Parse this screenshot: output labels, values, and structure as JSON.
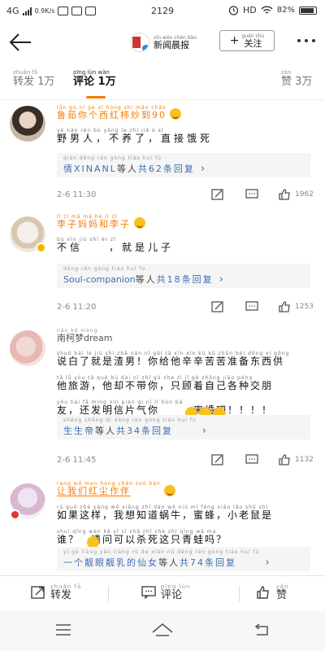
{
  "status_bar": {
    "network": "4G",
    "speed": "0.9K/s",
    "time": "2129",
    "hd": "HD",
    "battery": "82%"
  },
  "nav": {
    "account_pinyin": "xīn wén chén bào",
    "account_name": "新闻晨报",
    "follow_pinyin": "guān zhù",
    "follow_label": "关注"
  },
  "tabs": [
    {
      "pinyin": "zhuǎn fā",
      "label": "转发",
      "count": "1万",
      "active": false
    },
    {
      "pinyin": "pīng lùn   wàn",
      "label": "评论",
      "count": "1万",
      "active": true
    },
    {
      "pinyin": "zàn",
      "label": "赞",
      "count": "3万",
      "active": false
    }
  ],
  "comments": [
    {
      "user_pinyin": "lǚn  gù  ní  gè  xī  hóng shì mǎo chǎo",
      "username": "鲁茹你个西红柿炒到90",
      "text_pinyin": "yě  nán rén   bù yǎng le   zhí  jiē  è  sǐ",
      "text": "野男人，不养了，直接饿死",
      "reply_pinyin": "qián      děng rén  gòng   tiáo huí  fù",
      "reply_user": "倩XINANL",
      "reply_mid": "等人",
      "reply_count": "共62条回复",
      "time": "2-6 11:30",
      "likes": "1962"
    },
    {
      "user_pinyin": "lǐ   zǐ  mā mā  hé  lǐ  zǐ",
      "username": "李子妈妈和李子",
      "text_pinyin": "bù  xìn      jiù  shì  ér  zǐ",
      "text": "不信　　，就是儿子",
      "reply_pinyin": "                  děng rén   gòng    tiáo huí  fù",
      "reply_user": "Soul-companion",
      "reply_mid": "等人",
      "reply_count": "共18条回复",
      "time": "2-6 11:20",
      "likes": "1253"
    },
    {
      "user_pinyin": "nán kē mèng",
      "username": "南柯梦dream",
      "text_lines": [
        {
          "pinyin": "shuō bái  le  jiù shì zhā nán    nǐ gěi tā xīn xīn kǔ kǔ zhǔn bèi dōng xi gōng",
          "text": "说白了就是渣男！你给他辛辛苦苦准备东西供"
        },
        {
          "pinyin": "tā lǚ yóu     tā què bú dài nǐ     zhǐ gù zhe zì jǐ gè zhǒng jiāo péng",
          "text": "他旅游，他却不带你，只顾着自己各种交朋"
        },
        {
          "pinyin": "yǒu   hái fā míng xìn piàn qì nǐ        lí  hūn  bā",
          "text": "友，还发明信片气你　　　离婚吧！！！！"
        }
      ],
      "reply_pinyin": "shēng shēng  dì  děng rén   gòng   tiáo huí  fù",
      "reply_user": "生生帝",
      "reply_mid": "等人",
      "reply_count": "共34条回复",
      "time": "2-6 11:45",
      "likes": "1132"
    },
    {
      "user_pinyin": "ràng wǒ men hóng chén zuò bàn",
      "username": "让我们红尘作伴",
      "text_lines": [
        {
          "pinyin": "rú guǒ zhè yàng     wǒ xiǎng zhī dào wō niú    mì fēng    xiǎo lǎo shǔ shì",
          "text": "如果这样，我想知道蜗牛，蜜蜂，小老鼠是"
        },
        {
          "pinyin": "shuí        qǐng wèn kě  yǐ  sǐ  shā zhī zhè  zhǐ qīng wā ma",
          "text": "谁？　请问可以杀死这只青蛙吗？"
        }
      ],
      "reply_pinyin": "yī gè  liàng yǎn liàng rǔ  de xiān nǚ děng rén   gòng    tiáo huí  fù",
      "reply_user": "一个靓眼靓乳的仙女",
      "reply_mid": "等人",
      "reply_count": "共74条回复",
      "time": "",
      "likes": ""
    }
  ],
  "bottom_bar": {
    "repost_pinyin": "zhuǎn fā",
    "repost_label": "转发",
    "comment_pinyin": "pīng lùn",
    "comment_label": "评论",
    "like_pinyin": "zàn",
    "like_label": "赞"
  },
  "colors": {
    "accent": "#f57c00",
    "link": "#3d6fb4"
  }
}
